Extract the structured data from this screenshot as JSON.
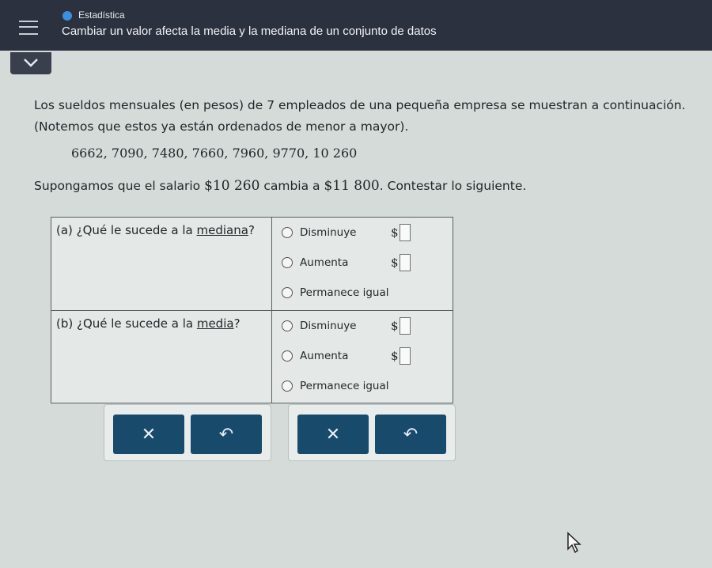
{
  "header": {
    "topic": "Estadística",
    "title": "Cambiar un valor afecta la media y la mediana de un conjunto de datos"
  },
  "problem": {
    "intro_line1": "Los sueldos mensuales (en pesos) de 7 empleados de una pequeña empresa se muestran a continuación.",
    "intro_line2": "(Notemos que estos ya están ordenados de menor a mayor).",
    "values": "6662, 7090, 7480, 7660, 7960, 9770, 10 260",
    "change_prefix": "Supongamos que el salario ",
    "old_salary": "$10 260",
    "change_middle": " cambia a ",
    "new_salary": "$11 800",
    "change_suffix": ". Contestar lo siguiente."
  },
  "question_a": {
    "prefix": "(a)  ¿Qué le sucede a la ",
    "term": "mediana",
    "suffix": "?",
    "options": [
      "Disminuye",
      "Aumenta",
      "Permanece igual"
    ],
    "currency": "$"
  },
  "question_b": {
    "prefix": "(b)  ¿Qué le sucede a la ",
    "term": "media",
    "suffix": "?",
    "options": [
      "Disminuye",
      "Aumenta",
      "Permanece igual"
    ],
    "currency": "$"
  },
  "controls": {
    "clear_glyph": "✕",
    "undo_glyph": "↶"
  },
  "colors": {
    "header_bg": "#2c3140",
    "button_bg": "#184a6c",
    "topic_dot": "#3d8fdd"
  }
}
